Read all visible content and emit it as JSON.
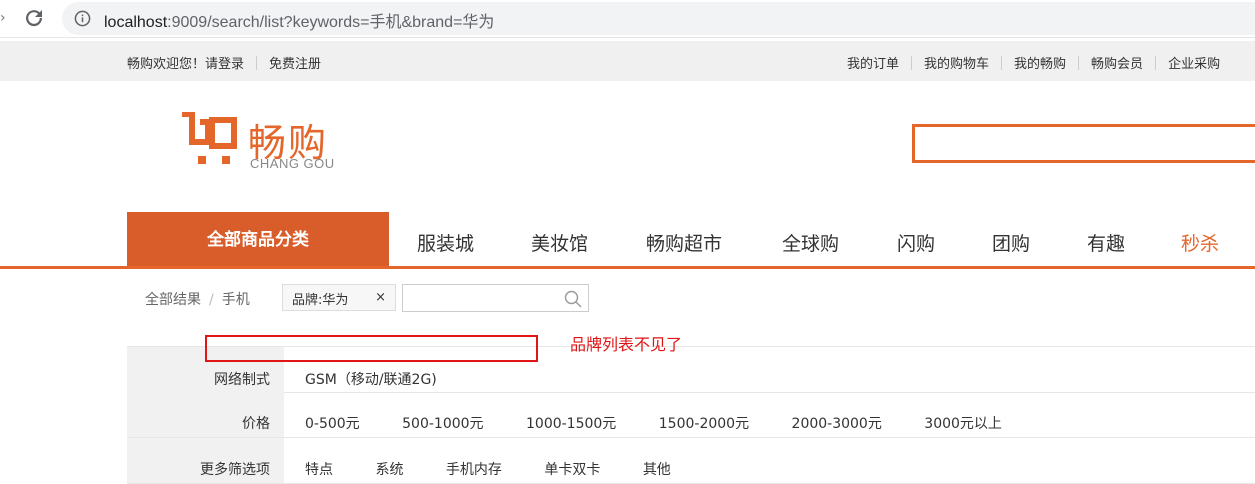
{
  "browser": {
    "url_host": "localhost",
    "url_rest": ":9009/search/list?keywords=手机&brand=华为"
  },
  "shortcut": {
    "welcome": "畅购欢迎您！",
    "login": "请登录",
    "register": "免费注册",
    "links": [
      "我的订单",
      "我的购物车",
      "我的畅购",
      "畅购会员",
      "企业采购"
    ]
  },
  "logo": {
    "name": "畅购",
    "sub": "CHANG GOU"
  },
  "nav": {
    "all_categories": "全部商品分类",
    "items": [
      "服装城",
      "美妆馆",
      "畅购超市",
      "全球购",
      "闪购",
      "团购",
      "有趣",
      "秒杀"
    ]
  },
  "breadcrumb": {
    "all": "全部结果",
    "current": "手机"
  },
  "selected_tag": {
    "label": "品牌:华为",
    "close": "×"
  },
  "filters": [
    {
      "label": "网络制式",
      "values": [
        "GSM（移动/联通2G)"
      ]
    },
    {
      "label": "价格",
      "values": [
        "0-500元",
        "500-1000元",
        "1000-1500元",
        "1500-2000元",
        "2000-3000元",
        "3000元以上"
      ]
    },
    {
      "label": "更多筛选项",
      "values": [
        "特点",
        "系统",
        "手机内存",
        "单卡双卡",
        "其他"
      ]
    }
  ],
  "annotation": {
    "text": "品牌列表不见了"
  },
  "colors": {
    "accent": "#e4662b",
    "annotation": "#e01515"
  }
}
